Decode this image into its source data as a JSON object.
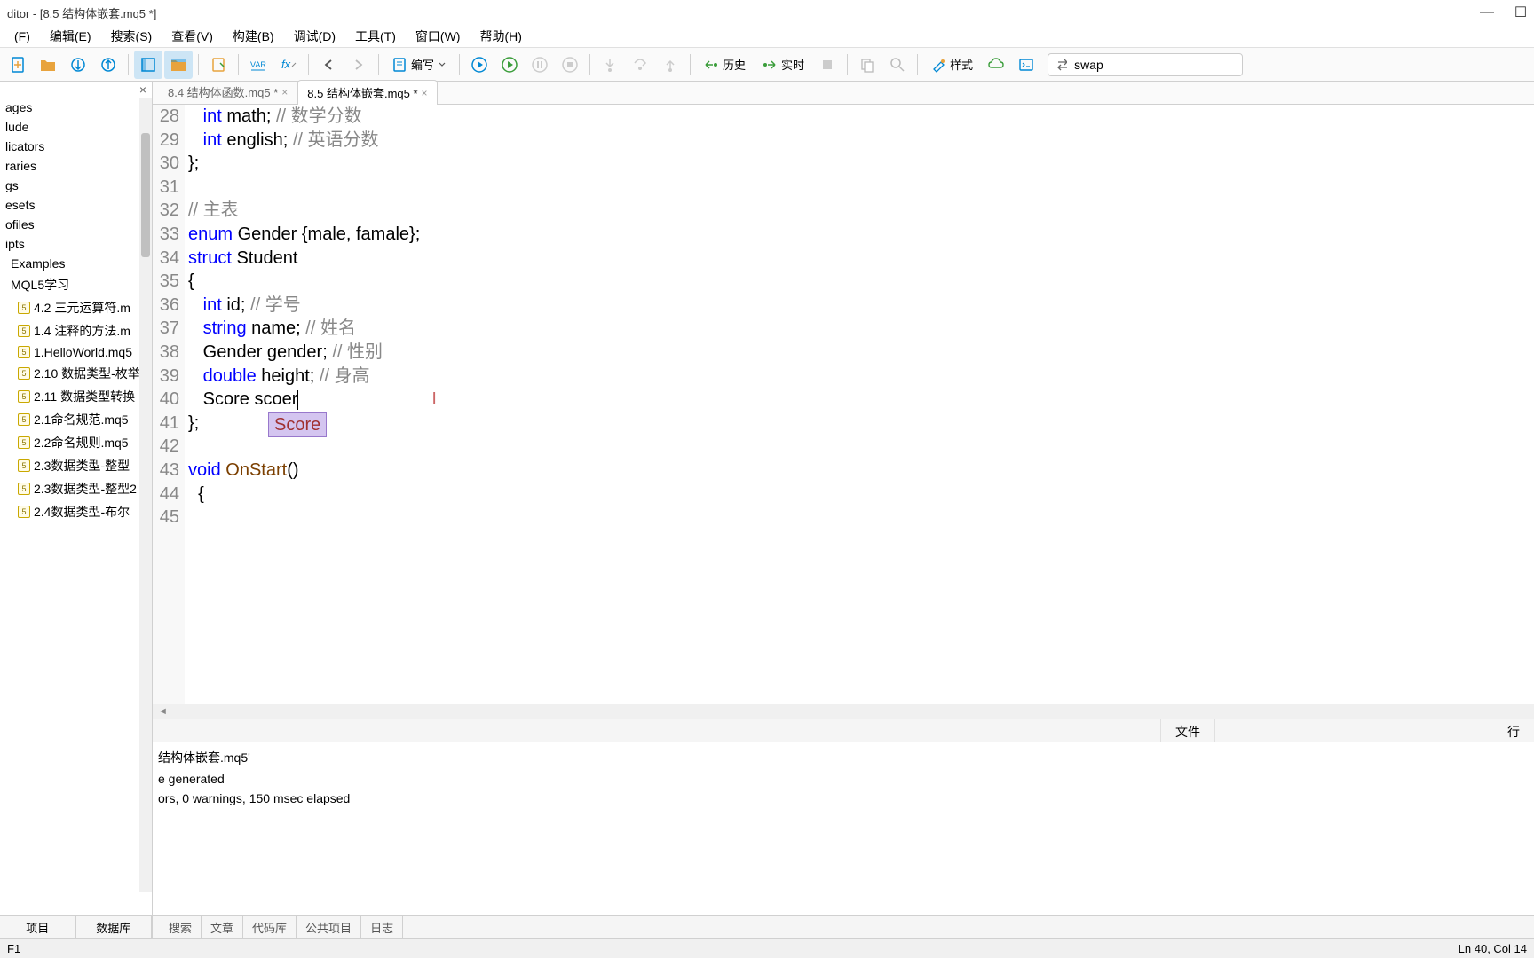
{
  "window": {
    "title": "ditor - [8.5 结构体嵌套.mq5 *]"
  },
  "menu": {
    "items": [
      "(F)",
      "编辑(E)",
      "搜索(S)",
      "查看(V)",
      "构建(B)",
      "调试(D)",
      "工具(T)",
      "窗口(W)",
      "帮助(H)"
    ]
  },
  "toolbar": {
    "compile_label": "编写",
    "history_label": "历史",
    "live_label": "实时",
    "styles_label": "样式",
    "search_value": "swap"
  },
  "sidebar": {
    "roots": [
      "ages",
      "lude",
      "licators",
      "raries",
      "gs",
      "esets",
      "ofiles",
      "ipts"
    ],
    "folders": [
      "Examples",
      "MQL5学习"
    ],
    "files": [
      "4.2 三元运算符.m",
      "1.4 注释的方法.m",
      "1.HelloWorld.mq5",
      "2.10 数据类型-枚举",
      "2.11 数据类型转换",
      "2.1命名规范.mq5",
      "2.2命名规则.mq5",
      "2.3数据类型-整型",
      "2.3数据类型-整型2",
      "2.4数据类型-布尔"
    ],
    "tabs": [
      "项目",
      "数据库"
    ]
  },
  "tabs": {
    "inactive": "8.4 结构体函数.mq5 *",
    "active": "8.5 结构体嵌套.mq5 *"
  },
  "code": {
    "lines": [
      {
        "n": 28,
        "t": "   int math; // 数学分数",
        "kw": [
          "int"
        ],
        "cm": "// 数学分数"
      },
      {
        "n": 29,
        "t": "   int english; // 英语分数",
        "kw": [
          "int"
        ],
        "cm": "// 英语分数"
      },
      {
        "n": 30,
        "t": "};"
      },
      {
        "n": 31,
        "t": ""
      },
      {
        "n": 32,
        "t": "// 主表",
        "cm": "// 主表"
      },
      {
        "n": 33,
        "t": "enum Gender {male, famale};",
        "kw": [
          "enum"
        ]
      },
      {
        "n": 34,
        "t": "struct Student",
        "kw": [
          "struct"
        ]
      },
      {
        "n": 35,
        "t": "{"
      },
      {
        "n": 36,
        "t": "   int id; // 学号",
        "kw": [
          "int"
        ],
        "cm": "// 学号"
      },
      {
        "n": 37,
        "t": "   string name; // 姓名",
        "kw": [
          "string"
        ],
        "cm": "// 姓名"
      },
      {
        "n": 38,
        "t": "   Gender gender; // 性别",
        "cm": "// 性别"
      },
      {
        "n": 39,
        "t": "   double height; // 身高",
        "kw": [
          "double"
        ],
        "cm": "// 身高"
      },
      {
        "n": 40,
        "t": "   Score scoer"
      },
      {
        "n": 41,
        "t": "};"
      },
      {
        "n": 42,
        "t": ""
      },
      {
        "n": 43,
        "t": "void OnStart()",
        "kw": [
          "void"
        ],
        "fn": "OnStart"
      },
      {
        "n": 44,
        "t": "  {"
      },
      {
        "n": 45,
        "t": ""
      }
    ],
    "autocomplete": "Score"
  },
  "output": {
    "header_file": "文件",
    "header_line": "行",
    "lines": [
      "结构体嵌套.mq5'",
      "e generated",
      "ors, 0 warnings, 150 msec elapsed"
    ],
    "tabs": [
      "搜索",
      "文章",
      "代码库",
      "公共项目",
      "日志"
    ]
  },
  "status": {
    "left": "F1",
    "right": "Ln 40, Col 14"
  }
}
